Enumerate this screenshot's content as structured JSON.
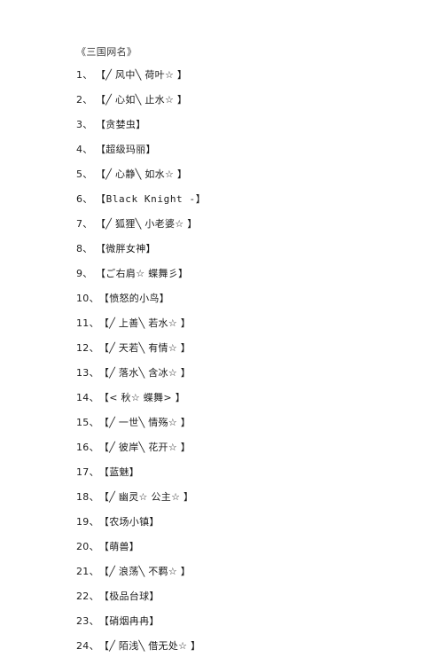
{
  "document": {
    "title": "《三国网名》",
    "background_color": "#ffffff",
    "text_color": "#1c1c1c",
    "list_marker": "、"
  },
  "list": {
    "items": [
      {
        "index": "1",
        "text": "【╱ 风中╲ 荷叶☆ 】",
        "mono": false
      },
      {
        "index": "2",
        "text": "【╱ 心如╲ 止水☆ 】",
        "mono": false
      },
      {
        "index": "3",
        "text": "【贪婪虫】",
        "mono": false
      },
      {
        "index": "4",
        "text": "【超级玛丽】",
        "mono": false
      },
      {
        "index": "5",
        "text": "【╱ 心静╲ 如水☆ 】",
        "mono": false
      },
      {
        "index": "6",
        "text": "【Black Knight -】",
        "mono": true
      },
      {
        "index": "7",
        "text": "【╱ 狐狸╲ 小老婆☆ 】",
        "mono": false
      },
      {
        "index": "8",
        "text": "【微胖女神】",
        "mono": false
      },
      {
        "index": "9",
        "text": "【ご右肩☆ 蝶舞彡】",
        "mono": false
      },
      {
        "index": "10",
        "text": "【愤怒的小鸟】",
        "mono": false
      },
      {
        "index": "11",
        "text": "【╱ 上善╲ 若水☆ 】",
        "mono": false
      },
      {
        "index": "12",
        "text": "【╱ 天若╲ 有情☆ 】",
        "mono": false
      },
      {
        "index": "13",
        "text": "【╱ 落水╲ 含冰☆ 】",
        "mono": false
      },
      {
        "index": "14",
        "text": "【< 秋☆ 蝶舞> 】",
        "mono": false
      },
      {
        "index": "15",
        "text": "【╱ 一世╲ 情殇☆ 】",
        "mono": false
      },
      {
        "index": "16",
        "text": "【╱ 彼岸╲ 花开☆ 】",
        "mono": false
      },
      {
        "index": "17",
        "text": "【蓝魅】",
        "mono": false
      },
      {
        "index": "18",
        "text": "【╱ 幽灵☆ 公主☆ 】",
        "mono": false
      },
      {
        "index": "19",
        "text": "【农场小镇】",
        "mono": false
      },
      {
        "index": "20",
        "text": "【萌兽】",
        "mono": false
      },
      {
        "index": "21",
        "text": "【╱ 浪荡╲ 不羁☆ 】",
        "mono": false
      },
      {
        "index": "22",
        "text": "【极品台球】",
        "mono": false
      },
      {
        "index": "23",
        "text": "【硝烟冉冉】",
        "mono": false
      },
      {
        "index": "24",
        "text": "【╱ 陌浅╲ 借无处☆ 】",
        "mono": false
      }
    ]
  }
}
